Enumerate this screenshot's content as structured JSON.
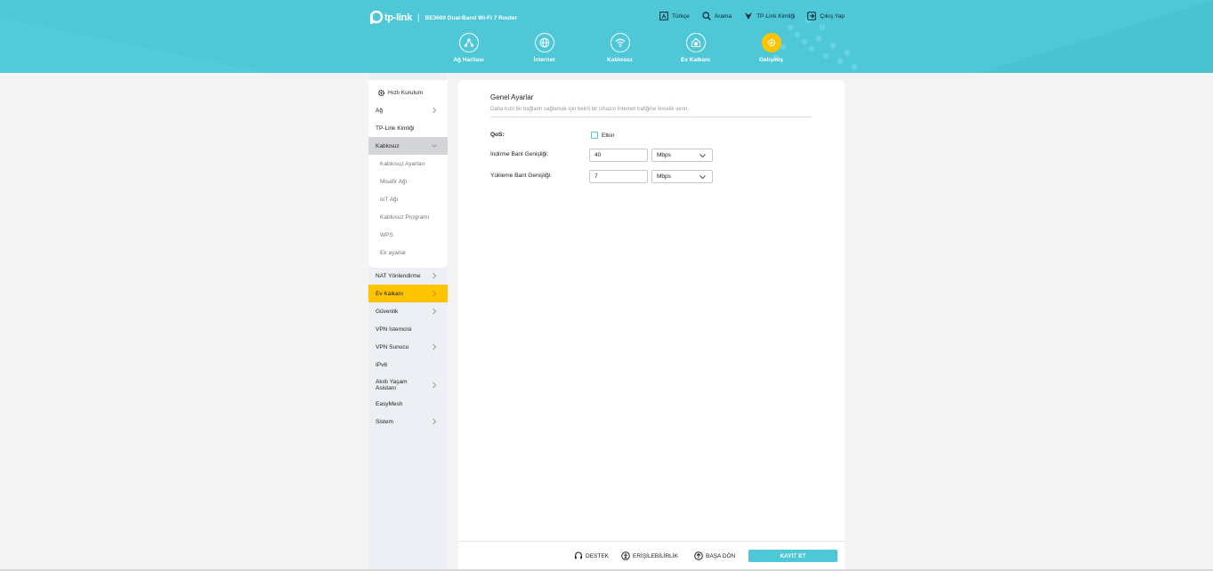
{
  "header": {
    "brand": "tp-link",
    "model": "BE3600 Dual-Band Wi-Fi 7 Router",
    "links": [
      {
        "id": "language",
        "label": "Türkçe",
        "icon": "language-icon"
      },
      {
        "id": "search",
        "label": "Arama",
        "icon": "search-icon"
      },
      {
        "id": "tplink-id",
        "label": "TP-Link Kimliği",
        "icon": "tplink-id-icon"
      },
      {
        "id": "logout",
        "label": "Çıkış Yap",
        "icon": "logout-icon"
      }
    ],
    "tabs": [
      {
        "id": "network-map",
        "label": "Ağ Haritası",
        "icon": "network-map-icon"
      },
      {
        "id": "internet",
        "label": "İnternet",
        "icon": "globe-icon"
      },
      {
        "id": "wireless",
        "label": "Kablosuz",
        "icon": "wifi-icon"
      },
      {
        "id": "homeshield",
        "label": "Ev Kalkanı",
        "icon": "home-shield-icon"
      },
      {
        "id": "advanced",
        "label": "Gelişmiş",
        "icon": "gear-icon",
        "active": true
      }
    ]
  },
  "sidebar": {
    "quick_setup": "Hızlı Kurulum",
    "items": [
      {
        "label": "Ağ",
        "chevron": true
      },
      {
        "label": "TP-Link Kimliği",
        "chevron": false
      },
      {
        "label": "Kablosuz",
        "chevron": true,
        "open": true
      },
      {
        "label": "Kablosuz Ayarları",
        "sub": true
      },
      {
        "label": "Misafir Ağı",
        "sub": true
      },
      {
        "label": "IoT Ağı",
        "sub": true
      },
      {
        "label": "Kablosuz Programı",
        "sub": true
      },
      {
        "label": "WPS",
        "sub": true
      },
      {
        "label": "Ek ayarlar",
        "sub": true
      },
      {
        "label": "NAT Yönlendirme",
        "chevron": true
      },
      {
        "label": "Ev Kalkanı",
        "chevron": true,
        "highlight": true
      },
      {
        "label": "Güvenlik",
        "chevron": true
      },
      {
        "label": "VPN İstemcisi",
        "chevron": false
      },
      {
        "label": "VPN Sunucu",
        "chevron": true
      },
      {
        "label": "IPv6",
        "chevron": false
      },
      {
        "label": "Akıllı Yaşam Asistanı",
        "chevron": true
      },
      {
        "label": "EasyMesh",
        "chevron": false
      },
      {
        "label": "Sistem",
        "chevron": true
      }
    ]
  },
  "content": {
    "title": "Genel Ayarlar",
    "description": "Daha hızlı bir bağlantı sağlamak için belirli bir cihazın İnternet trafiğine öncelik verin.",
    "qos": {
      "label": "QoS:",
      "checkbox_label": "Etkin",
      "checked": false
    },
    "download": {
      "label": "İndirme Bant Genişliği:",
      "value": "40",
      "unit": "Mbps"
    },
    "upload": {
      "label": "Yükleme Bant Genişliği:",
      "value": "7",
      "unit": "Mbps"
    }
  },
  "footer": {
    "support": "DESTEK",
    "accessibility": "ERİŞİLEBİLİRLİK",
    "back_to_top": "BAŞA DÖN",
    "save": "KAYIT ET"
  },
  "colors": {
    "header": "#4ec8d6",
    "accent_yellow": "#ffc400",
    "save_button": "#4ec8d6"
  }
}
